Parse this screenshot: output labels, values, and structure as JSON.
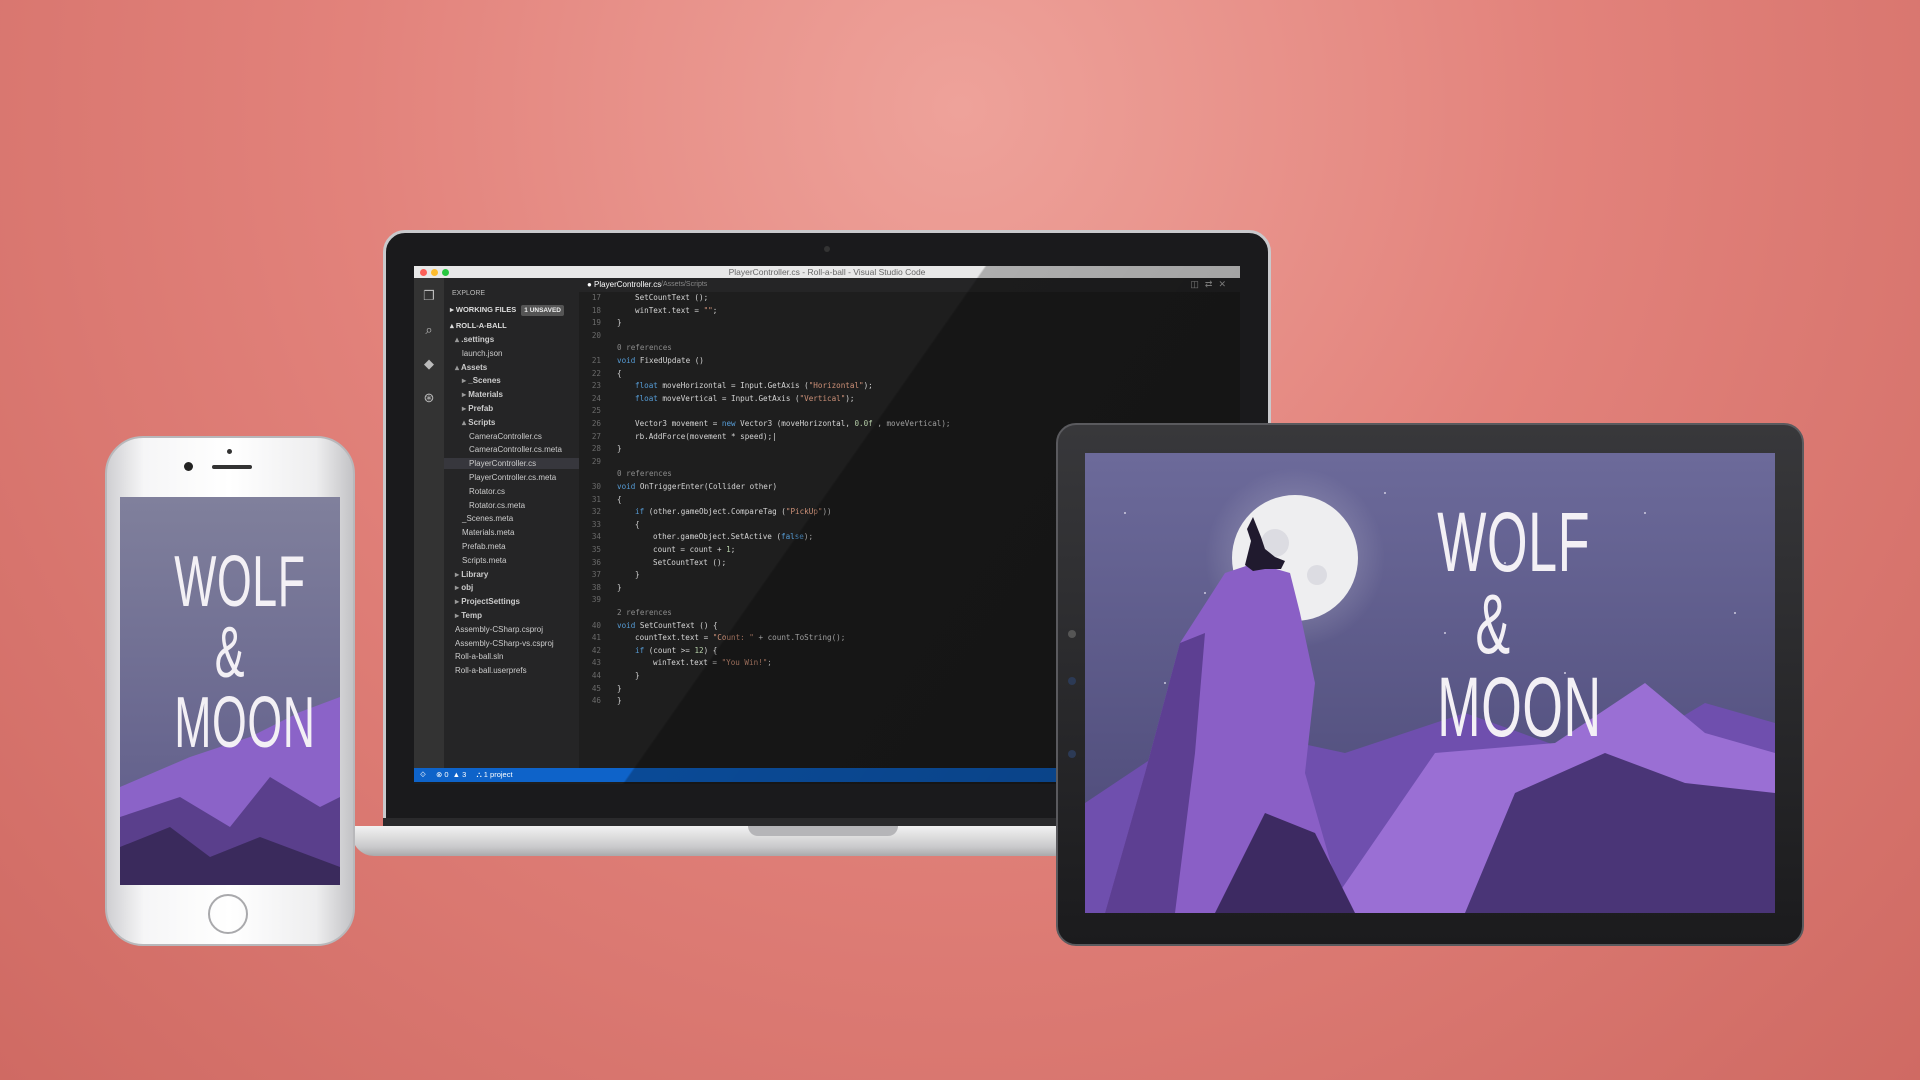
{
  "laptop": {
    "window_title": "PlayerController.cs - Roll-a-ball - Visual Studio Code",
    "explorer": {
      "header": "EXPLORE",
      "working_files": "WORKING FILES",
      "unsaved_badge": "1 UNSAVED",
      "project": "ROLL-A-BALL",
      "items": [
        {
          "label": ".settings",
          "indent": 1,
          "arrow": "▴",
          "bold": true
        },
        {
          "label": "launch.json",
          "indent": 2,
          "arrow": ""
        },
        {
          "label": "Assets",
          "indent": 1,
          "arrow": "▴",
          "bold": true
        },
        {
          "label": "_Scenes",
          "indent": 2,
          "arrow": "▸",
          "bold": true
        },
        {
          "label": "Materials",
          "indent": 2,
          "arrow": "▸",
          "bold": true
        },
        {
          "label": "Prefab",
          "indent": 2,
          "arrow": "▸",
          "bold": true
        },
        {
          "label": "Scripts",
          "indent": 2,
          "arrow": "▴",
          "bold": true
        },
        {
          "label": "CameraController.cs",
          "indent": 3,
          "arrow": ""
        },
        {
          "label": "CameraController.cs.meta",
          "indent": 3,
          "arrow": ""
        },
        {
          "label": "PlayerController.cs",
          "indent": 3,
          "arrow": "",
          "selected": true
        },
        {
          "label": "PlayerController.cs.meta",
          "indent": 3,
          "arrow": ""
        },
        {
          "label": "Rotator.cs",
          "indent": 3,
          "arrow": ""
        },
        {
          "label": "Rotator.cs.meta",
          "indent": 3,
          "arrow": ""
        },
        {
          "label": "_Scenes.meta",
          "indent": 2,
          "arrow": ""
        },
        {
          "label": "Materials.meta",
          "indent": 2,
          "arrow": ""
        },
        {
          "label": "Prefab.meta",
          "indent": 2,
          "arrow": ""
        },
        {
          "label": "Scripts.meta",
          "indent": 2,
          "arrow": ""
        },
        {
          "label": "Library",
          "indent": 1,
          "arrow": "▸",
          "bold": true
        },
        {
          "label": "obj",
          "indent": 1,
          "arrow": "▸",
          "bold": true
        },
        {
          "label": "ProjectSettings",
          "indent": 1,
          "arrow": "▸",
          "bold": true
        },
        {
          "label": "Temp",
          "indent": 1,
          "arrow": "▸",
          "bold": true
        },
        {
          "label": "Assembly-CSharp.csproj",
          "indent": 1,
          "arrow": ""
        },
        {
          "label": "Assembly-CSharp-vs.csproj",
          "indent": 1,
          "arrow": ""
        },
        {
          "label": "Roll-a-ball.sln",
          "indent": 1,
          "arrow": ""
        },
        {
          "label": "Roll-a-ball.userprefs",
          "indent": 1,
          "arrow": ""
        }
      ]
    },
    "tab": {
      "file": "● PlayerController.cs",
      "path": "/Assets/Scripts"
    },
    "code_lines": [
      {
        "n": "17",
        "indent": 1,
        "html": "SetCountText ();"
      },
      {
        "n": "18",
        "indent": 1,
        "html": "winText.text = <span class=\"str\">\"\"</span>;"
      },
      {
        "n": "19",
        "indent": 0,
        "html": "}"
      },
      {
        "n": "20",
        "indent": 0,
        "html": ""
      },
      {
        "n": "",
        "indent": 0,
        "html": "<span class=\"cm\">0 references</span>"
      },
      {
        "n": "21",
        "indent": 0,
        "html": "<span class=\"kw\">void</span> FixedUpdate ()"
      },
      {
        "n": "22",
        "indent": 0,
        "html": "{"
      },
      {
        "n": "23",
        "indent": 1,
        "html": "<span class=\"kw\">float</span> moveHorizontal = Input.GetAxis (<span class=\"str\">\"Horizontal\"</span>);"
      },
      {
        "n": "24",
        "indent": 1,
        "html": "<span class=\"kw\">float</span> moveVertical = Input.GetAxis (<span class=\"str\">\"Vertical\"</span>);"
      },
      {
        "n": "25",
        "indent": 0,
        "html": ""
      },
      {
        "n": "26",
        "indent": 1,
        "html": "Vector3 movement = <span class=\"kw\">new</span> Vector3 (moveHorizontal, <span class=\"num\">0.0f</span> , moveVertical);"
      },
      {
        "n": "27",
        "indent": 1,
        "html": "rb.AddForce(movement * speed);|"
      },
      {
        "n": "28",
        "indent": 0,
        "html": "}"
      },
      {
        "n": "29",
        "indent": 0,
        "html": ""
      },
      {
        "n": "",
        "indent": 0,
        "html": "<span class=\"cm\">0 references</span>"
      },
      {
        "n": "30",
        "indent": 0,
        "html": "<span class=\"kw\">void</span> OnTriggerEnter(Collider other)"
      },
      {
        "n": "31",
        "indent": 0,
        "html": "{"
      },
      {
        "n": "32",
        "indent": 1,
        "html": "<span class=\"kw\">if</span> (other.gameObject.CompareTag (<span class=\"str\">\"PickUp\"</span>))"
      },
      {
        "n": "33",
        "indent": 1,
        "html": "{"
      },
      {
        "n": "34",
        "indent": 2,
        "html": "other.gameObject.SetActive (<span class=\"kw\">false</span>);"
      },
      {
        "n": "35",
        "indent": 2,
        "html": "count = count + <span class=\"num\">1</span>;"
      },
      {
        "n": "36",
        "indent": 2,
        "html": "SetCountText ();"
      },
      {
        "n": "37",
        "indent": 1,
        "html": "}"
      },
      {
        "n": "38",
        "indent": 0,
        "html": "}"
      },
      {
        "n": "39",
        "indent": 0,
        "html": ""
      },
      {
        "n": "",
        "indent": 0,
        "html": "<span class=\"cm\">2 references</span>"
      },
      {
        "n": "40",
        "indent": 0,
        "html": "<span class=\"kw\">void</span> SetCountText () {"
      },
      {
        "n": "41",
        "indent": 1,
        "html": "countText.text = <span class=\"str\">\"Count: \"</span> + count.ToString();"
      },
      {
        "n": "42",
        "indent": 1,
        "html": "<span class=\"kw\">if</span> (count &gt;= <span class=\"num\">12</span>) {"
      },
      {
        "n": "43",
        "indent": 2,
        "html": "winText.text = <span class=\"str\">\"You Win!\"</span>;"
      },
      {
        "n": "44",
        "indent": 1,
        "html": "}"
      },
      {
        "n": "45",
        "indent": 0,
        "html": "}"
      },
      {
        "n": "46",
        "indent": 0,
        "html": "}"
      }
    ],
    "status": {
      "branch_icon": "git-branch-icon",
      "errors": "⊗ 0",
      "warnings": "▲ 3",
      "project": "⛬ 1 project"
    }
  },
  "poster": {
    "line1": "WOLF",
    "line2": "&",
    "line3": "MOON"
  },
  "colors": {
    "background": "#e2827b",
    "vscode_status": "#0e63c9",
    "poster_sky_top": "#6a6a9a",
    "poster_mountain": "#8d62c9"
  }
}
